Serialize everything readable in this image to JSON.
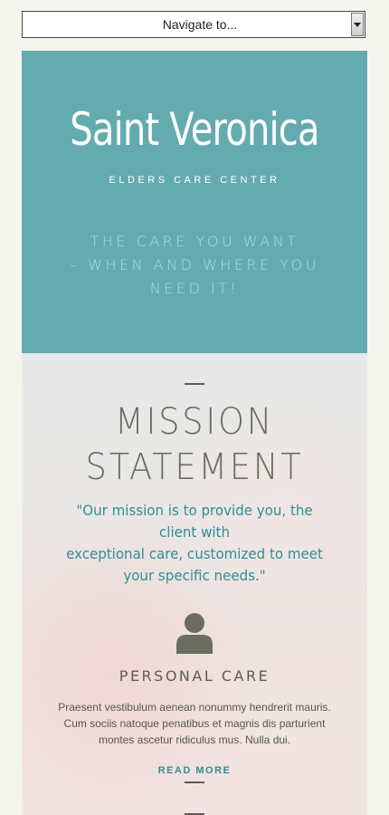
{
  "nav": {
    "select_value": "Navigate to..."
  },
  "header": {
    "brand_name": "Saint Veronica",
    "brand_subtitle": "ELDERS CARE CENTER",
    "slogan_line1": "THE CARE YOU WANT",
    "slogan_line2": "– WHEN AND WHERE YOU",
    "slogan_line3": "NEED IT!"
  },
  "mission": {
    "title_line1": "MISSION",
    "title_line2": "STATEMENT",
    "quote_line1": "\"Our mission is to provide you, the",
    "quote_line2": "client with",
    "quote_line3": "exceptional care, customized to meet",
    "quote_line4": "your specific needs.\""
  },
  "service": {
    "icon": "person-icon",
    "title": "PERSONAL CARE",
    "text_line1": "Praesent vestibulum aenean nonummy hendrerit mauris.",
    "text_line2": "Cum sociis natoque penatibus et magnis dis parturient",
    "text_line3": "montes ascetur ridiculus mus. Nulla dui.",
    "read_more": "READ MORE"
  },
  "colors": {
    "teal_header": "#64abb0",
    "teal_text": "#2f8e97",
    "slogan": "#a9dbe0",
    "olive_text": "#6b6d5e"
  }
}
